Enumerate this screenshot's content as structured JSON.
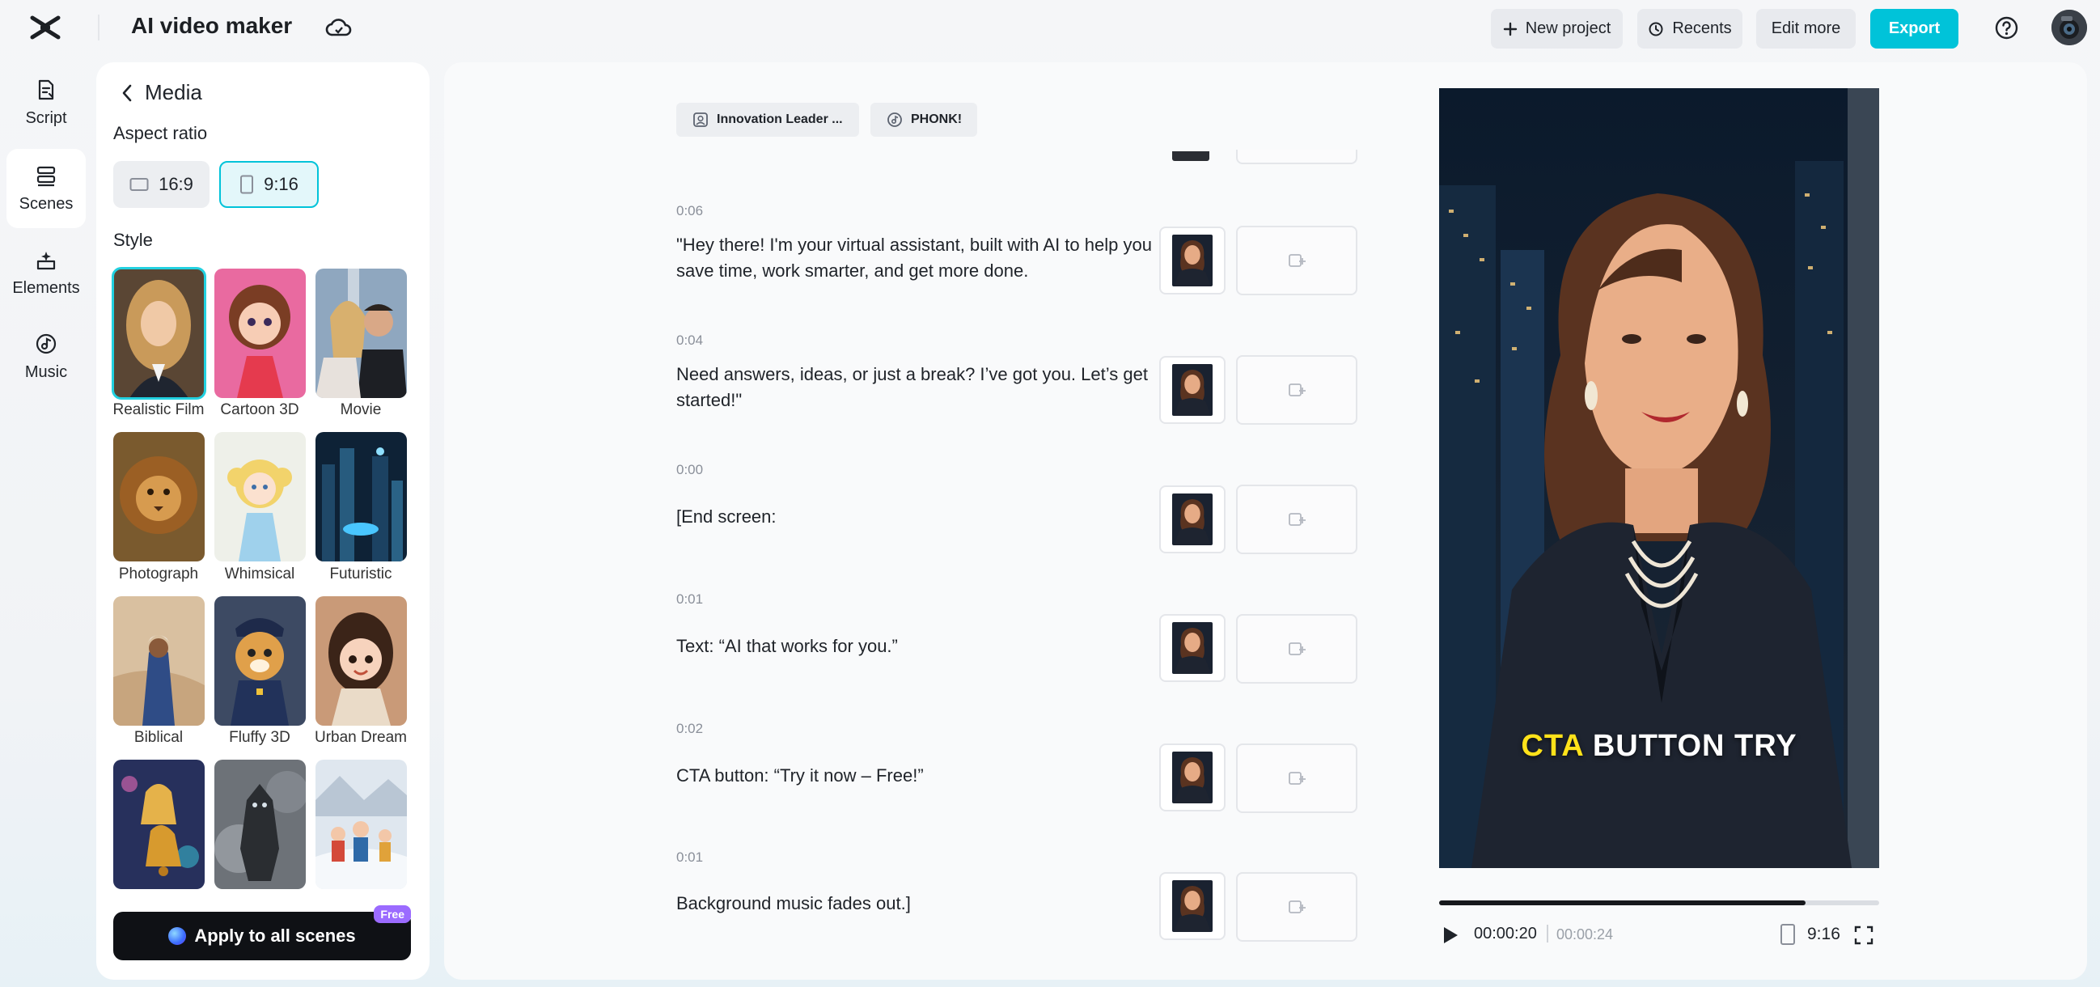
{
  "header": {
    "app_title": "AI video maker",
    "new_project": "New project",
    "recents": "Recents",
    "edit_more": "Edit more",
    "export": "Export"
  },
  "nav": [
    {
      "label": "Script",
      "icon": "script-icon"
    },
    {
      "label": "Scenes",
      "icon": "scenes-icon",
      "active": true
    },
    {
      "label": "Elements",
      "icon": "elements-icon"
    },
    {
      "label": "Music",
      "icon": "music-icon"
    }
  ],
  "media": {
    "title": "Media",
    "aspect_ratio_label": "Aspect ratio",
    "ratios": [
      "16:9",
      "9:16"
    ],
    "selected_ratio": "9:16",
    "style_label": "Style",
    "styles": [
      "Realistic Film",
      "Cartoon 3D",
      "Movie",
      "Photograph",
      "Whimsical",
      "Futuristic",
      "Biblical",
      "Fluffy 3D",
      "Urban Dream"
    ],
    "selected_style": "Realistic Film",
    "apply_button": "Apply to all scenes",
    "free_badge": "Free"
  },
  "chips": {
    "voice": "Innovation Leader ...",
    "music": "PHONK!"
  },
  "scenes": [
    {
      "time": "0:06",
      "text": "\"Hey there! I'm your virtual assistant, built with AI to help you save time, work smarter, and get more done."
    },
    {
      "time": "0:04",
      "text": "Need answers, ideas, or just a break? I’ve got you. Let’s get started!\""
    },
    {
      "time": "0:00",
      "text": "[End screen:"
    },
    {
      "time": "0:01",
      "text": "Text: “AI that works for you.”"
    },
    {
      "time": "0:02",
      "text": "CTA button: “Try it now – Free!”"
    },
    {
      "time": "0:01",
      "text": "Background music fades out.]"
    }
  ],
  "preview": {
    "caption_highlight": "CTA",
    "caption_rest": "BUTTON    TRY",
    "current_time": "00:00:20",
    "total_time": "00:00:24",
    "progress_fraction": 0.833,
    "ratio": "9:16"
  },
  "colors": {
    "accent": "#00c3d9",
    "caption_highlight": "#ffe21a",
    "free_badge": "#9b6bff"
  }
}
